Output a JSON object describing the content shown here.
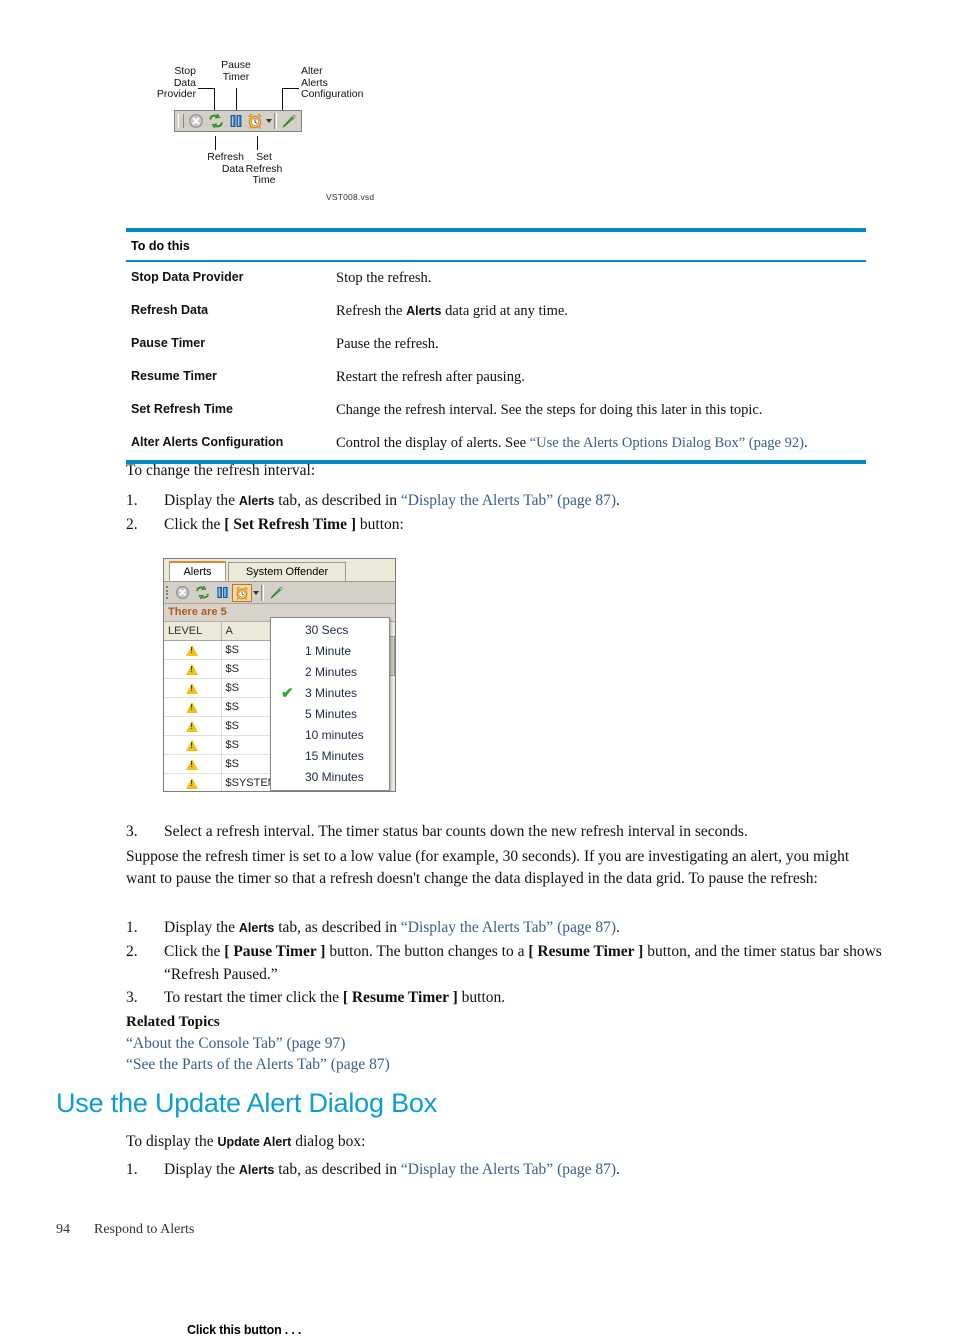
{
  "figure_toolbar": {
    "callouts": {
      "stop_data_provider": "Stop\nData\nProvider",
      "pause_timer": "Pause\nTimer",
      "alter_alerts_configuration": "Alter\nAlerts\nConfiguration",
      "refresh_data": "Refresh\nData",
      "set_refresh_time": "Set\nRefresh\nTime"
    },
    "source_file": "VST008.vsd",
    "buttons": [
      {
        "name": "stop-data-provider-icon",
        "label": "Stop Data Provider"
      },
      {
        "name": "refresh-data-icon",
        "label": "Refresh Data"
      },
      {
        "name": "pause-timer-icon",
        "label": "Pause Timer"
      },
      {
        "name": "set-refresh-time-icon",
        "label": "Set Refresh Time"
      },
      {
        "name": "alter-alerts-configuration-icon",
        "label": "Alter Alerts Configuration"
      }
    ]
  },
  "table": {
    "headers": [
      "Click this button . . .",
      "To do this"
    ],
    "rows": [
      {
        "button": "Stop Data Provider",
        "desc_pre": "Stop the refresh.",
        "desc_bold": "",
        "desc_post": "",
        "link": "",
        "link_post": ""
      },
      {
        "button": "Refresh Data",
        "desc_pre": "Refresh the ",
        "desc_bold": "Alerts",
        "desc_post": " data grid at any time.",
        "link": "",
        "link_post": ""
      },
      {
        "button": "Pause Timer",
        "desc_pre": "Pause the refresh.",
        "desc_bold": "",
        "desc_post": "",
        "link": "",
        "link_post": ""
      },
      {
        "button": "Resume Timer",
        "desc_pre": "Restart the refresh after pausing.",
        "desc_bold": "",
        "desc_post": "",
        "link": "",
        "link_post": ""
      },
      {
        "button": "Set Refresh Time",
        "desc_pre": "Change the refresh interval. See the steps for doing this later in this topic.",
        "desc_bold": "",
        "desc_post": "",
        "link": "",
        "link_post": ""
      },
      {
        "button": "Alter Alerts Configuration",
        "desc_pre": "Control the display of alerts. See ",
        "desc_bold": "",
        "desc_post": "",
        "link": "“Use the Alerts Options Dialog Box” (page 92)",
        "link_post": "."
      }
    ]
  },
  "section_change_interval": {
    "intro": "To change the refresh interval:",
    "steps": [
      {
        "num": "1.",
        "pre": "Display the ",
        "bold": "Alerts",
        "mid": " tab, as described in ",
        "link": "“Display the Alerts Tab” (page 87)",
        "post": "."
      },
      {
        "num": "2.",
        "pre": "Click the ",
        "bold": "[ Set Refresh Time ]",
        "mid": " button:",
        "link": "",
        "post": ""
      }
    ],
    "step3": {
      "num": "3.",
      "text": "Select a refresh interval. The timer status bar counts down the new refresh interval in seconds."
    }
  },
  "figure_dropdown": {
    "tabs": [
      {
        "label": "Alerts",
        "active": true
      },
      {
        "label": "System Offender",
        "active": false
      }
    ],
    "status_bar_text": "There are 5",
    "grid": {
      "columns": [
        "LEVEL",
        "A"
      ],
      "rows": [
        {
          "level_icon": "warning-icon",
          "a": "$S"
        },
        {
          "level_icon": "warning-icon",
          "a": "$S"
        },
        {
          "level_icon": "warning-icon",
          "a": "$S"
        },
        {
          "level_icon": "warning-icon",
          "a": "$S"
        },
        {
          "level_icon": "warning-icon",
          "a": "$S"
        },
        {
          "level_icon": "warning-icon",
          "a": "$S"
        },
        {
          "level_icon": "warning-icon",
          "a": "$S"
        },
        {
          "level_icon": "warning-icon",
          "a": "$SYSTEM"
        }
      ]
    },
    "menu": {
      "items": [
        {
          "label": "30 Secs",
          "checked": false
        },
        {
          "label": "1 Minute",
          "checked": false
        },
        {
          "label": "2 Minutes",
          "checked": false
        },
        {
          "label": "3 Minutes",
          "checked": true
        },
        {
          "label": "5 Minutes",
          "checked": false
        },
        {
          "label": "10 minutes",
          "checked": false
        },
        {
          "label": "15 Minutes",
          "checked": false
        },
        {
          "label": "30 Minutes",
          "checked": false
        }
      ],
      "check_glyph": "✔"
    }
  },
  "section_pause": {
    "paragraph": "Suppose the refresh timer is set to a low value (for example, 30 seconds). If you are investigating an alert, you might want to pause the timer so that a refresh doesn't change the data displayed in the data grid. To pause the refresh:",
    "steps": [
      {
        "num": "1.",
        "pre": "Display the ",
        "bold": "Alerts",
        "mid": " tab, as described in ",
        "link": "“Display the Alerts Tab” (page 87)",
        "post": "."
      },
      {
        "num": "2.",
        "pre": "Click the ",
        "bold": "[ Pause Timer ]",
        "mid": " button. The button changes to a ",
        "bold2": "[ Resume Timer ]",
        "post": " button, and the timer status bar shows “Refresh Paused.”"
      },
      {
        "num": "3.",
        "pre": "To restart the timer click the ",
        "bold": "[ Resume Timer ]",
        "mid": " button.",
        "link": "",
        "post": ""
      }
    ]
  },
  "related_topics": {
    "heading": "Related Topics",
    "links": [
      "“About the Console Tab” (page 97)",
      "“See the Parts of the Alerts Tab” (page 87)"
    ]
  },
  "section_update_alert": {
    "heading": "Use the Update Alert Dialog Box",
    "intro_pre": "To display the ",
    "intro_bold": "Update Alert",
    "intro_post": " dialog box:",
    "steps": [
      {
        "num": "1.",
        "pre": "Display the ",
        "bold": "Alerts",
        "mid": " tab, as described in ",
        "link": "“Display the Alerts Tab” (page 87)",
        "post": "."
      }
    ]
  },
  "footer": {
    "page_number": "94",
    "section": "Respond to Alerts"
  },
  "colors": {
    "rule_blue": "#0089c4",
    "heading_blue": "#0b9cd8",
    "link_blue": "#3a5e8c"
  }
}
